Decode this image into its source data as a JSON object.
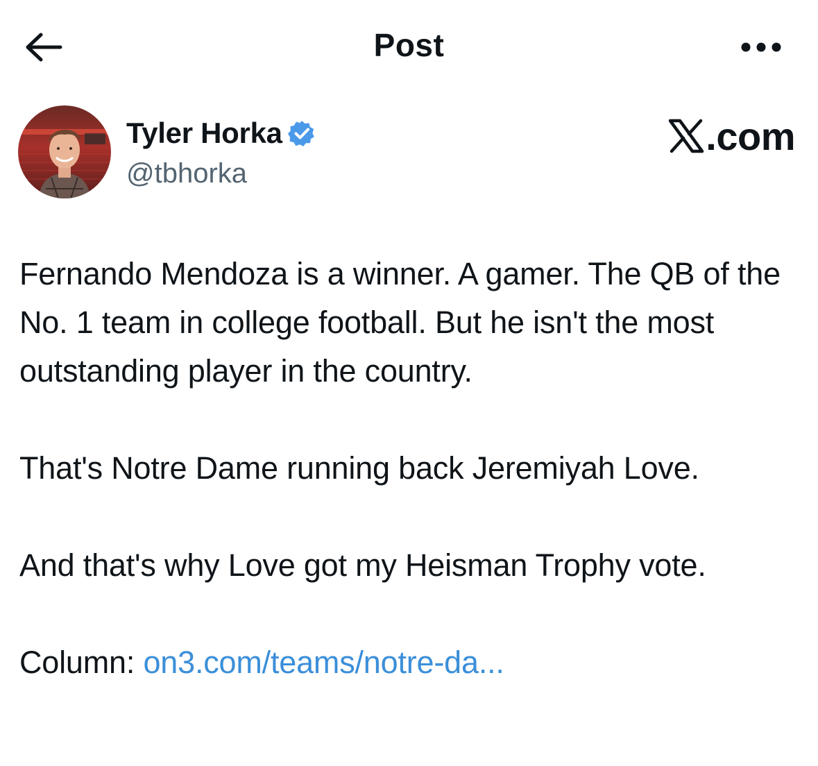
{
  "header": {
    "title": "Post",
    "back_icon": "arrow-left-icon",
    "more_icon": "more-horizontal-icon"
  },
  "author": {
    "name": "Tyler Horka",
    "handle": "@tbhorka",
    "verified": true,
    "verified_color": "#4b99e9"
  },
  "watermark": {
    "logo_icon": "x-logo-icon",
    "text": ".com"
  },
  "post": {
    "paragraphs": [
      "Fernando Mendoza is a winner. A gamer. The QB of the No. 1 team in college football. But he isn't the most outstanding player in the country.",
      "That's Notre Dame running back Jeremiyah Love.",
      "And that's why Love got my Heisman Trophy vote."
    ],
    "column_label": "Column: ",
    "link_text": "on3.com/teams/notre-da...",
    "link_color": "#3b8fd9"
  }
}
